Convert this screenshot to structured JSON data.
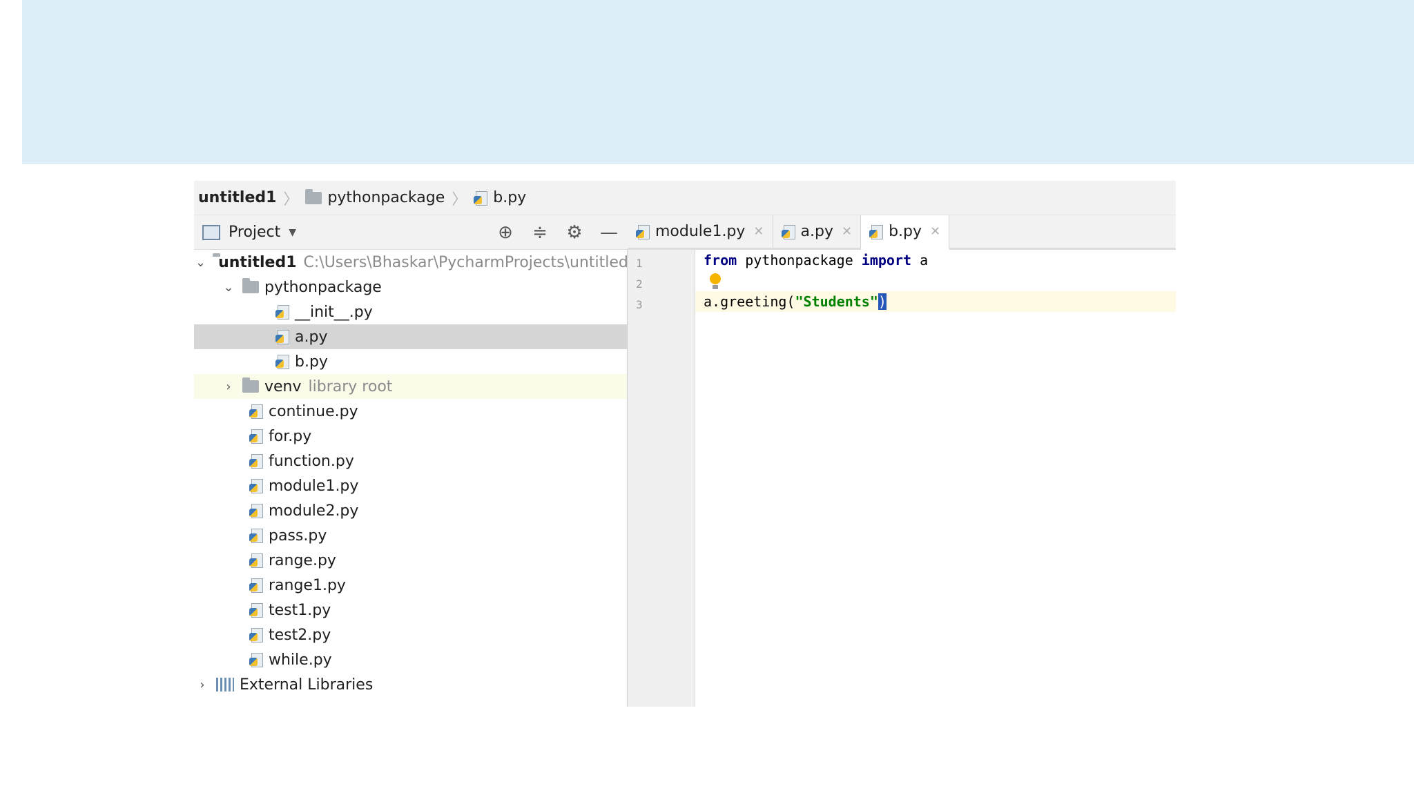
{
  "breadcrumb": {
    "root": "untitled1",
    "folder": "pythonpackage",
    "file": "b.py"
  },
  "project_panel": {
    "title": "Project",
    "tools": {
      "locate": "⊕",
      "collapse": "≑",
      "settings": "⚙",
      "hide": "—"
    }
  },
  "tree": {
    "root": {
      "name": "untitled1",
      "path": "C:\\Users\\Bhaskar\\PycharmProjects\\untitled"
    },
    "package": "pythonpackage",
    "package_files": [
      "__init__.py",
      "a.py",
      "b.py"
    ],
    "selected_file": "a.py",
    "venv": {
      "name": "venv",
      "hint": "library root"
    },
    "root_files": [
      "continue.py",
      "for.py",
      "function.py",
      "module1.py",
      "module2.py",
      "pass.py",
      "range.py",
      "range1.py",
      "test1.py",
      "test2.py",
      "while.py"
    ],
    "external": "External Libraries"
  },
  "tabs": [
    {
      "label": "module1.py",
      "active": false
    },
    {
      "label": "a.py",
      "active": false
    },
    {
      "label": "b.py",
      "active": true
    }
  ],
  "editor": {
    "line_numbers": [
      "1",
      "2",
      "3"
    ],
    "line1": {
      "kw1": "from",
      "mid": " pythonpackage ",
      "kw2": "import",
      "tail": " a"
    },
    "line3": {
      "call": "a.greeting(",
      "string": "\"Students\"",
      "close": ")"
    }
  }
}
